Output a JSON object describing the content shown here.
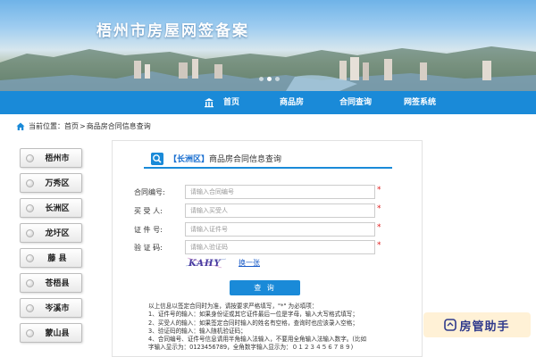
{
  "banner": {
    "title": "梧州市房屋网签备案",
    "carousel_dots": 3,
    "active_dot": 1
  },
  "nav": {
    "items": [
      {
        "label": "首页"
      },
      {
        "label": "商品房"
      },
      {
        "label": "合同查询"
      },
      {
        "label": "网签系统"
      }
    ]
  },
  "breadcrumb": {
    "prefix": "当前位置：",
    "home": "首页",
    "separator": ">",
    "current": "商品房合同信息查询"
  },
  "sidebar": {
    "items": [
      {
        "label": "梧州市"
      },
      {
        "label": "万秀区"
      },
      {
        "label": "长洲区"
      },
      {
        "label": "龙圩区"
      },
      {
        "label": "藤 县"
      },
      {
        "label": "苍梧县"
      },
      {
        "label": "岑溪市"
      },
      {
        "label": "蒙山县"
      }
    ]
  },
  "panel": {
    "district": "【长洲区】",
    "title": "商品房合同信息查询",
    "fields": [
      {
        "label": "合同编号:",
        "placeholder": "请输入合同编号",
        "value": ""
      },
      {
        "label": "买 受 人:",
        "placeholder": "请输入买受人",
        "value": ""
      },
      {
        "label": "证 件 号:",
        "placeholder": "请输入证件号",
        "value": ""
      },
      {
        "label": "验 证 码:",
        "placeholder": "请输入验证码",
        "value": ""
      }
    ],
    "required_mark": "*",
    "captcha_text": "KAHY",
    "refresh_label": "换一张",
    "query_label": "查 询",
    "notes": [
      "以上信息以签定合同时为准，请按要求严格填写，\"*\" 为必填项：",
      "1、证件号的输入：如果身份证或其它证件最后一位是字母，输入大写格式填写；",
      "2、买受人的输入：如果签定合同时输入的姓名有空格，查询时也应该录入空格；",
      "3、验证码的输入：输入随机验证码；",
      "4、合同编号、证件号信息请用半角输入法输入，不要用全角输入法输入数字。(比如",
      "字输入显示为：0123456789，全角数字输入显示为：０１２３４５６７８９)"
    ]
  },
  "watermark": {
    "text": "房管助手"
  },
  "colors": {
    "primary": "#1a8ad8",
    "required": "#e02020",
    "link": "#1a5bc8",
    "district": "#1a6fd0"
  }
}
